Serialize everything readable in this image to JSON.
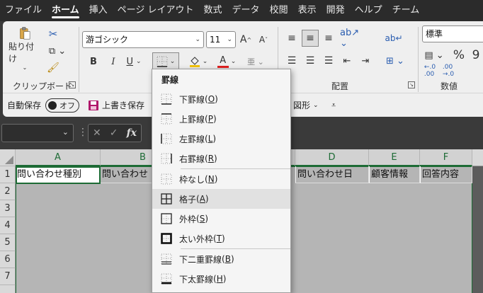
{
  "menu_tabs": [
    "ファイル",
    "ホーム",
    "挿入",
    "ページ レイアウト",
    "数式",
    "データ",
    "校閲",
    "表示",
    "開発",
    "ヘルプ",
    "チーム"
  ],
  "active_tab": "ホーム",
  "ribbon": {
    "clipboard": {
      "paste_label": "貼り付け",
      "group_label": "クリップボード"
    },
    "font": {
      "font_name": "游ゴシック",
      "font_size": "11",
      "grow_label": "A^",
      "shrink_label": "Aˇ",
      "bold": "B",
      "italic": "I",
      "underline": "U",
      "font_color_letter": "A",
      "highlight_color": "#f2c200",
      "font_color": "#e02020"
    },
    "alignment": {
      "group_label": "配置"
    },
    "number": {
      "format_value": "標準",
      "percent": "%",
      "comma": "9",
      "group_label": "数値"
    },
    "quick_access": {
      "autosave_label": "自動保存",
      "autosave_state": "オフ",
      "overwrite_save_label": "上書き保存",
      "shapes_label": "図形"
    }
  },
  "formula_bar": {
    "name_box_value": "",
    "fx_label": "fx"
  },
  "columns": [
    {
      "letter": "A",
      "header": "問い合わせ種別"
    },
    {
      "letter": "B",
      "header": "問い合わせ"
    },
    {
      "letter": "D",
      "header": "問い合わせ日"
    },
    {
      "letter": "E",
      "header": "顧客情報"
    },
    {
      "letter": "F",
      "header": "回答内容"
    }
  ],
  "rows": [
    "1",
    "2",
    "3",
    "4",
    "5",
    "6",
    "7"
  ],
  "border_menu": {
    "title": "罫線",
    "items": [
      {
        "label": "下罫線",
        "key": "O",
        "icon": "border-bottom-icon"
      },
      {
        "label": "上罫線",
        "key": "P",
        "icon": "border-top-icon"
      },
      {
        "label": "左罫線",
        "key": "L",
        "icon": "border-left-icon"
      },
      {
        "label": "右罫線",
        "key": "R",
        "icon": "border-right-icon"
      },
      {
        "label": "枠なし",
        "key": "N",
        "icon": "border-none-icon"
      },
      {
        "label": "格子",
        "key": "A",
        "icon": "border-all-icon"
      },
      {
        "label": "外枠",
        "key": "S",
        "icon": "border-outside-icon"
      },
      {
        "label": "太い外枠",
        "key": "T",
        "icon": "border-thick-outside-icon"
      },
      {
        "label": "下二重罫線",
        "key": "B",
        "icon": "border-double-bottom-icon"
      },
      {
        "label": "下太罫線",
        "key": "H",
        "icon": "border-thick-bottom-icon"
      }
    ],
    "hover_index": 5
  },
  "colors": {
    "accent_green": "#1d6b35",
    "ribbon_bg": "#efefef",
    "tabbar_bg": "#2b2b2b"
  }
}
